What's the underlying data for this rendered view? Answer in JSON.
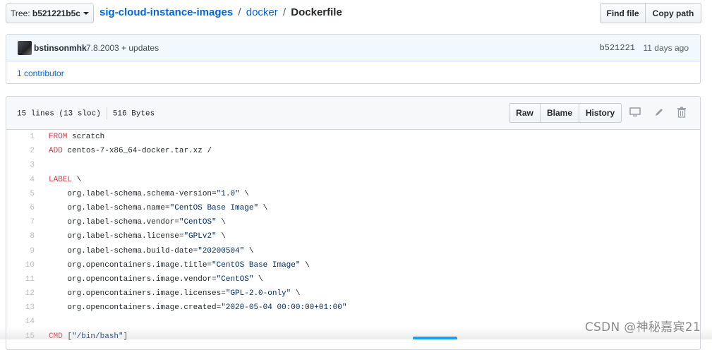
{
  "toolbar": {
    "branch_prefix": "Tree: ",
    "branch_label": "b521221b5c",
    "find_file": "Find file",
    "copy_path": "Copy path"
  },
  "breadcrumb": {
    "repo": "sig-cloud-instance-images",
    "folder": "docker",
    "separator": "/",
    "file": "Dockerfile"
  },
  "commit": {
    "author": "bstinsonmhk",
    "message": "7.8.2003 + updates",
    "sha": "b521221",
    "age": "11 days ago",
    "contributors": "1 contributor"
  },
  "file": {
    "lines_info": "15 lines (13 sloc)",
    "size": "516 Bytes",
    "raw": "Raw",
    "blame": "Blame",
    "history": "History"
  },
  "code_lines": [
    {
      "n": "1",
      "kw": "FROM",
      "rest": " scratch"
    },
    {
      "n": "2",
      "kw": "ADD",
      "rest": " centos-7-x86_64-docker.tar.xz /"
    },
    {
      "n": "3",
      "kw": "",
      "rest": ""
    },
    {
      "n": "4",
      "kw": "LABEL",
      "rest": " \\"
    },
    {
      "n": "5",
      "kw": "",
      "rest": "    org.label-schema.schema-version=\"1.0\" \\"
    },
    {
      "n": "6",
      "kw": "",
      "rest": "    org.label-schema.name=\"CentOS Base Image\" \\"
    },
    {
      "n": "7",
      "kw": "",
      "rest": "    org.label-schema.vendor=\"CentOS\" \\"
    },
    {
      "n": "8",
      "kw": "",
      "rest": "    org.label-schema.license=\"GPLv2\" \\"
    },
    {
      "n": "9",
      "kw": "",
      "rest": "    org.label-schema.build-date=\"20200504\" \\"
    },
    {
      "n": "10",
      "kw": "",
      "rest": "    org.opencontainers.image.title=\"CentOS Base Image\" \\"
    },
    {
      "n": "11",
      "kw": "",
      "rest": "    org.opencontainers.image.vendor=\"CentOS\" \\"
    },
    {
      "n": "12",
      "kw": "",
      "rest": "    org.opencontainers.image.licenses=\"GPL-2.0-only\" \\"
    },
    {
      "n": "13",
      "kw": "",
      "rest": "    org.opencontainers.image.created=\"2020-05-04 00:00:00+01:00\""
    },
    {
      "n": "14",
      "kw": "",
      "rest": ""
    },
    {
      "n": "15",
      "kw": "CMD",
      "rest": " [\"/bin/bash\"]"
    }
  ],
  "watermark": "CSDN @神秘嘉宾21",
  "colors": {
    "link": "#0366d6",
    "keyword": "#d73a49",
    "string": "#032f62",
    "line_number": "#babbbc",
    "commit_header_bg": "#f1f8ff"
  },
  "icons": [
    "caret-down-icon",
    "avatar",
    "desktop-icon",
    "pencil-icon",
    "trash-icon"
  ]
}
